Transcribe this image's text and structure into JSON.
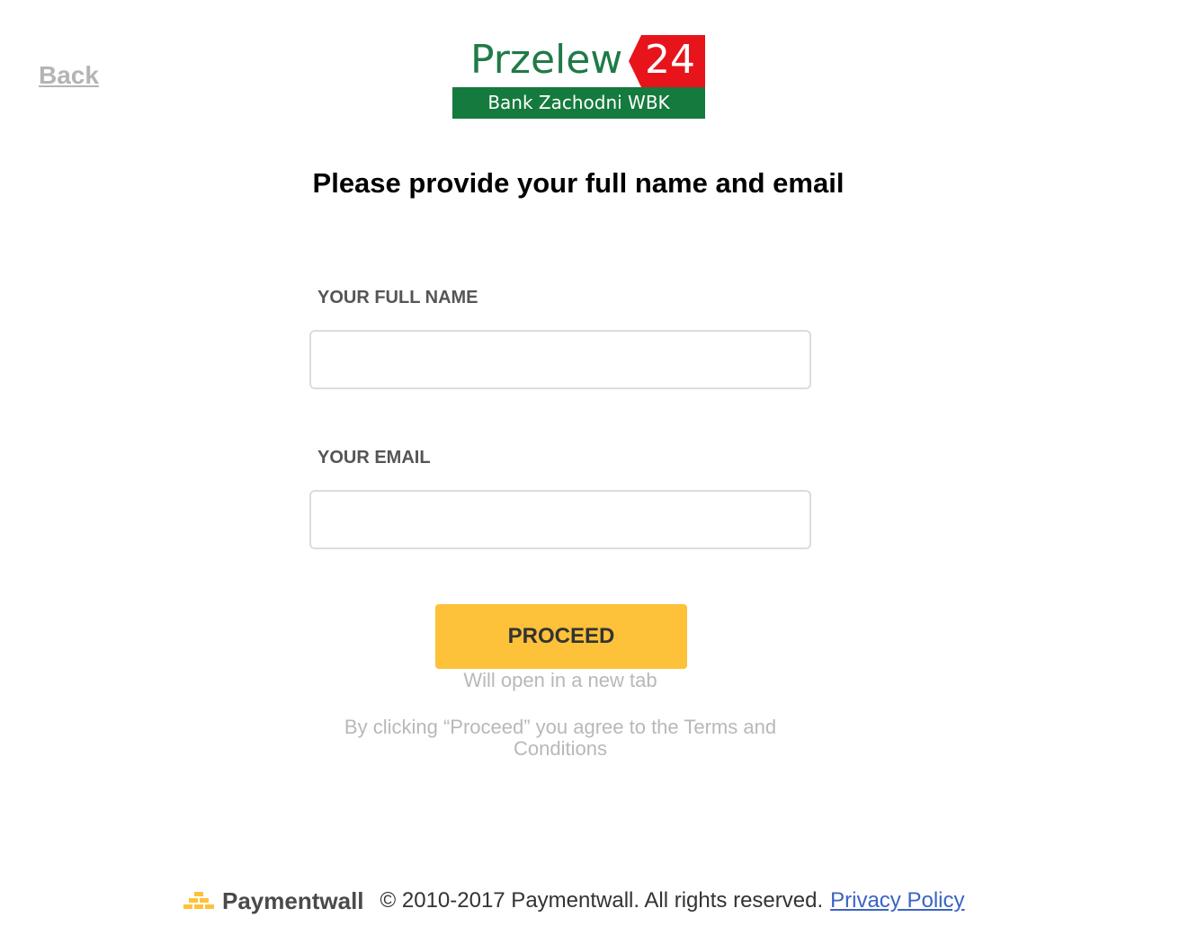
{
  "nav": {
    "back_label": "Back"
  },
  "logo": {
    "brand": "Przelew",
    "number": "24",
    "bank": "Bank Zachodni WBK"
  },
  "heading": "Please provide your full name and email",
  "form": {
    "name_label": "YOUR FULL NAME",
    "name_value": "",
    "email_label": "YOUR EMAIL",
    "email_value": "",
    "proceed_label": "PROCEED",
    "new_tab_note": "Will open in a new tab",
    "terms_note": "By clicking “Proceed” you agree to the Terms and Conditions"
  },
  "footer": {
    "brand": "Paymentwall",
    "copyright": "© 2010-2017 Paymentwall. All rights reserved.",
    "privacy_label": "Privacy Policy"
  },
  "colors": {
    "accent_button": "#fdc13a",
    "logo_green": "#157a3d",
    "logo_red": "#e8141b",
    "link_blue": "#3b63c4"
  }
}
